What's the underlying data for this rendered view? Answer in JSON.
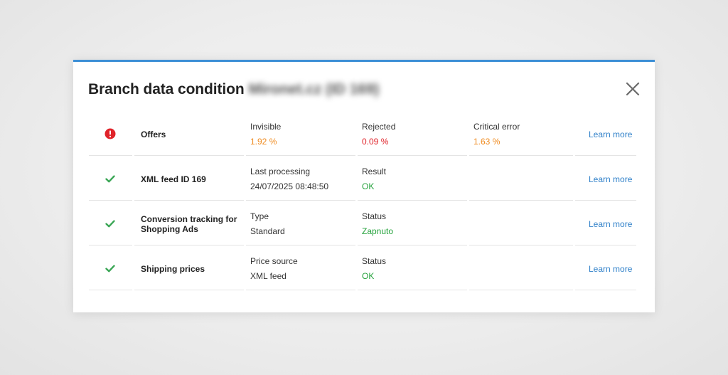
{
  "modal": {
    "title": "Branch data condition",
    "title_blurred_suffix": "Mironet.cz (ID 169)",
    "accent_color": "#3d8fd6"
  },
  "rows": [
    {
      "status_icon": "exclamation-circle-icon",
      "status_color": "#e0232a",
      "name": "Offers",
      "col_a": {
        "label": "Invisible",
        "value": "1.92 %"
      },
      "col_b": {
        "label": "Rejected",
        "value": "0.09 %"
      },
      "col_c": {
        "label": "Critical error",
        "value": "1.63 %"
      },
      "link": "Learn more"
    },
    {
      "status_icon": "checkmark-icon",
      "status_color": "#3aa655",
      "name": "XML feed ID 169",
      "col_a": {
        "label": "Last processing",
        "value": "24/07/2025 08:48:50"
      },
      "col_b": {
        "label": "Result",
        "value": "OK"
      },
      "link": "Learn more"
    },
    {
      "status_icon": "checkmark-icon",
      "status_color": "#3aa655",
      "name": "Conversion tracking for Shopping Ads",
      "col_a": {
        "label": "Type",
        "value": "Standard"
      },
      "col_b": {
        "label": "Status",
        "value": "Zapnuto"
      },
      "link": "Learn more"
    },
    {
      "status_icon": "checkmark-icon",
      "status_color": "#3aa655",
      "name": "Shipping prices",
      "col_a": {
        "label": "Price source",
        "value": "XML feed"
      },
      "col_b": {
        "label": "Status",
        "value": "OK"
      },
      "link": "Learn more"
    }
  ],
  "colors": {
    "link": "#2f80c9",
    "warning_orange": "#ef8a1e",
    "error_red": "#e0232a",
    "ok_green": "#25a23c"
  }
}
